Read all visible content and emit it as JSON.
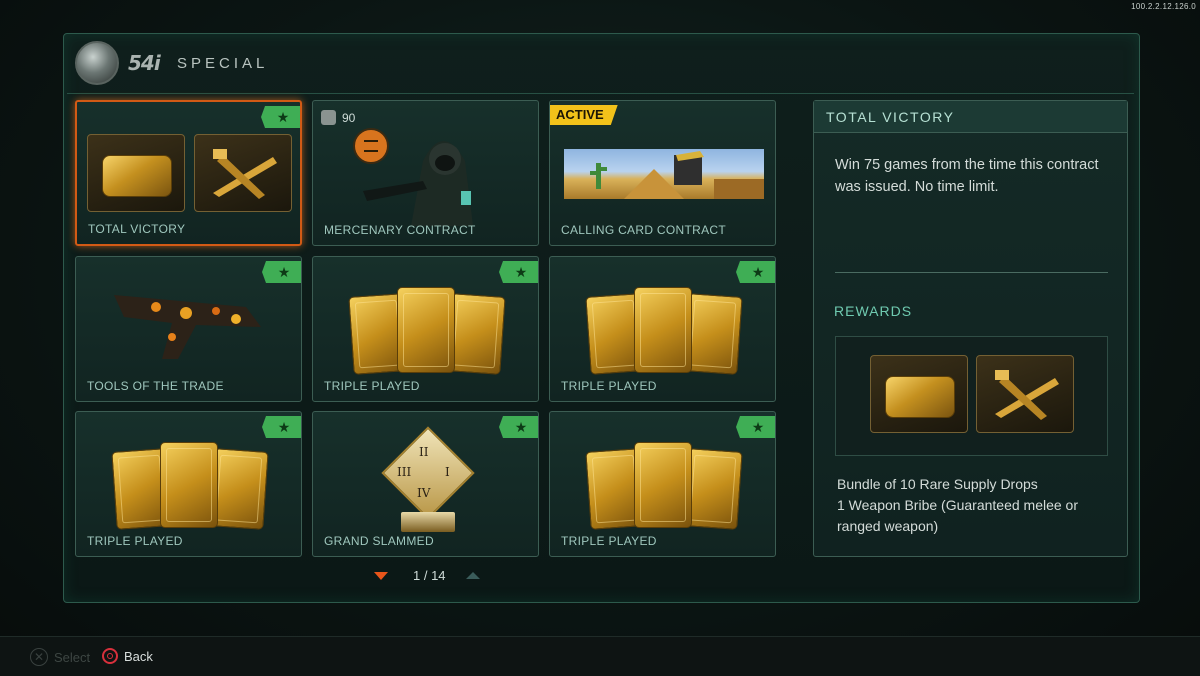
{
  "version": "100.2.2.12.126.0",
  "header": {
    "logo_text": "54i",
    "title": "SPECIAL"
  },
  "contracts": [
    {
      "label": "TOTAL VICTORY",
      "badge": "star"
    },
    {
      "label": "MERCENARY CONTRACT",
      "cost": "90"
    },
    {
      "label": "CALLING CARD CONTRACT",
      "badge_text": "ACTIVE"
    },
    {
      "label": "TOOLS OF THE TRADE",
      "badge": "star"
    },
    {
      "label": "TRIPLE PLAYED",
      "badge": "star"
    },
    {
      "label": "TRIPLE PLAYED",
      "badge": "star"
    },
    {
      "label": "TRIPLE PLAYED",
      "badge": "star"
    },
    {
      "label": "GRAND SLAMMED",
      "badge": "star",
      "numerals": [
        "II",
        "III",
        "I",
        "IV"
      ]
    },
    {
      "label": "TRIPLE PLAYED",
      "badge": "star"
    }
  ],
  "pager": {
    "text": "1 / 14"
  },
  "details": {
    "title": "TOTAL VICTORY",
    "description": "Win 75 games from the time this contract was issued. No time limit.",
    "rewards_label": "REWARDS",
    "reward_line_1": "Bundle of 10 Rare Supply Drops",
    "reward_line_2": "1 Weapon Bribe (Guaranteed melee or ranged weapon)"
  },
  "footer": {
    "select_label": "Select",
    "back_label": "Back"
  },
  "colors": {
    "accent_orange": "#d25a15",
    "star_green": "#3fae55",
    "active_yellow": "#f2c21a",
    "reward_label": "#6fcab0"
  },
  "icons": {
    "star": "star-icon",
    "cross": "cross-button-icon",
    "circle": "circle-button-icon"
  }
}
